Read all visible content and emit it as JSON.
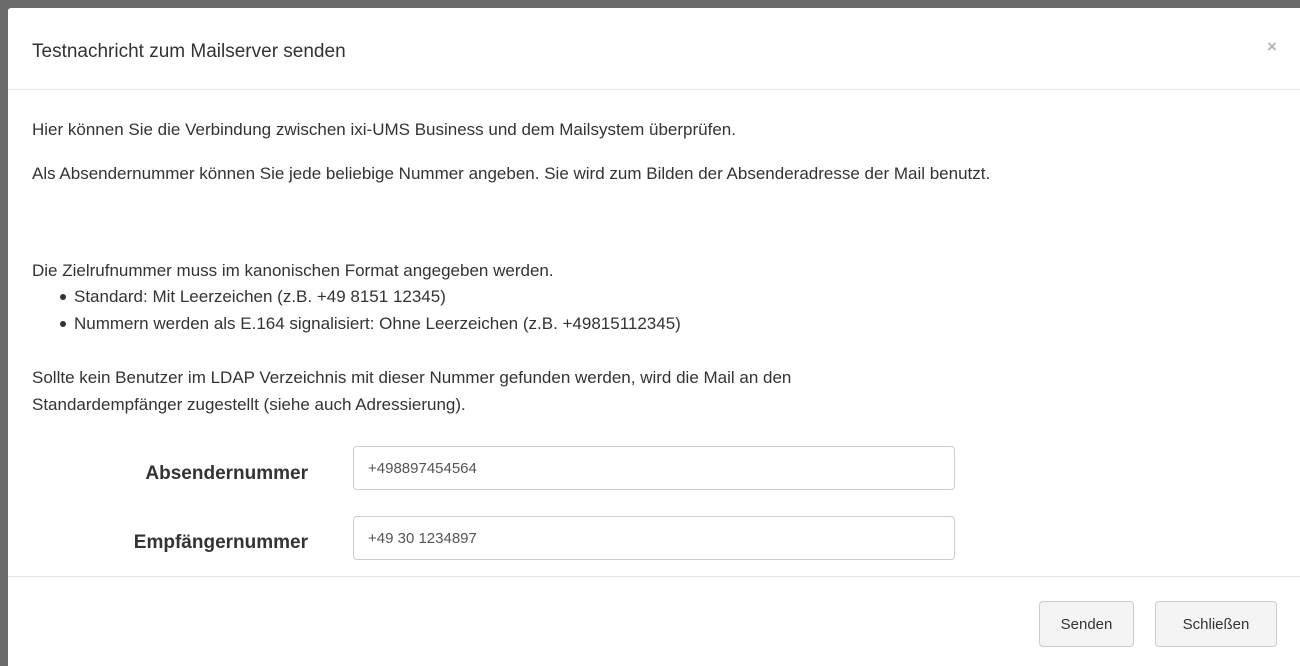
{
  "dialog": {
    "title": "Testnachricht zum Mailserver senden",
    "close_symbol": "×"
  },
  "body": {
    "intro": "Hier können Sie die Verbindung zwischen ixi-UMS Business und dem Mailsystem überprüfen.",
    "sender_info": "Als Absendernummer können Sie jede beliebige Nummer angeben. Sie wird zum Bilden der Absenderadresse der Mail benutzt.",
    "format_info": "Die Zielrufnummer muss im kanonischen Format angegeben werden.",
    "bullets": [
      "Standard: Mit Leerzeichen (z.B. +49 8151 12345)",
      "Nummern werden als E.164 signalisiert: Ohne Leerzeichen (z.B. +49815112345)"
    ],
    "ldap_info": "Sollte kein Benutzer im LDAP Verzeichnis mit dieser Nummer gefunden werden, wird die Mail an den Standardempfänger zugestellt (siehe auch Adressierung)."
  },
  "form": {
    "sender_label": "Absendernummer",
    "sender_value": "+498897454564",
    "recipient_label": "Empfängernummer",
    "recipient_value": "+49 30 1234897"
  },
  "footer": {
    "send_label": "Senden",
    "close_label": "Schließen"
  }
}
